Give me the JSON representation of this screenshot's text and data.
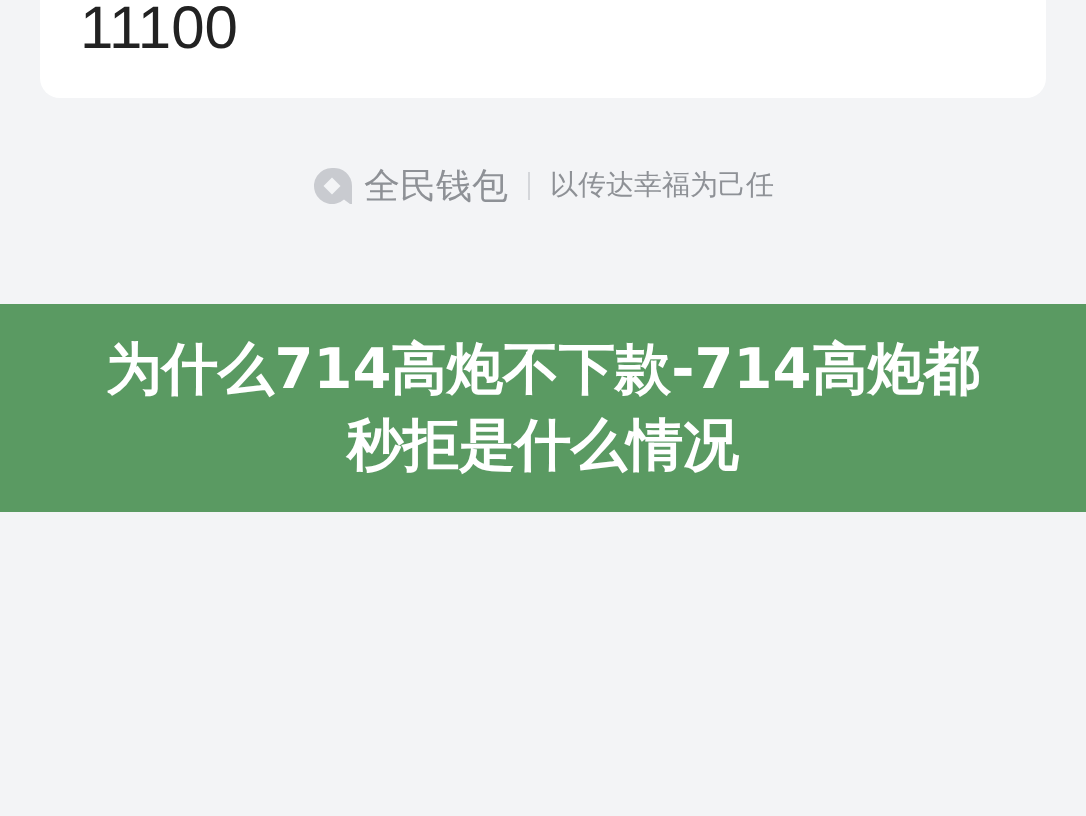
{
  "card": {
    "amount": "11100"
  },
  "footer": {
    "brand": "全民钱包",
    "slogan": "以传达幸福为己任"
  },
  "banner": {
    "title": "为什么714高炮不下款-714高炮都秒拒是什么情况"
  }
}
